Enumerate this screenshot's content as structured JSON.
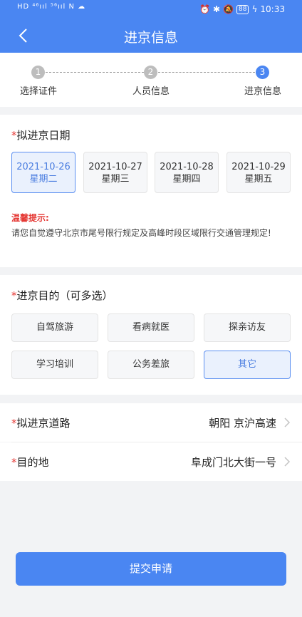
{
  "status_bar": {
    "left": "HD ⁴⁶ııl ⁵⁶ııl N ☁",
    "battery": "88",
    "time": "10:33"
  },
  "nav": {
    "title": "进京信息"
  },
  "steps": [
    {
      "num": "1",
      "label": "选择证件"
    },
    {
      "num": "2",
      "label": "人员信息"
    },
    {
      "num": "3",
      "label": "进京信息"
    }
  ],
  "date_section": {
    "required_mark": "*",
    "title": "拟进京日期",
    "dates": [
      {
        "date": "2021-10-26",
        "weekday": "星期二"
      },
      {
        "date": "2021-10-27",
        "weekday": "星期三"
      },
      {
        "date": "2021-10-28",
        "weekday": "星期四"
      },
      {
        "date": "2021-10-29",
        "weekday": "星期五"
      }
    ],
    "selected_date": "2021-10-26",
    "tip_title": "温馨提示:",
    "tip_text": "请您自觉遵守北京市尾号限行规定及高峰时段区域限行交通管理规定!"
  },
  "purpose_section": {
    "required_mark": "*",
    "title": "进京目的（可多选）",
    "options": [
      "自驾旅游",
      "看病就医",
      "探亲访友",
      "学习培训",
      "公务差旅",
      "其它"
    ],
    "selected": [
      "其它"
    ]
  },
  "route_row": {
    "required_mark": "*",
    "label": "拟进京道路",
    "value": "朝阳  京沪高速"
  },
  "destination_row": {
    "required_mark": "*",
    "label": "目的地",
    "value": "阜成门北大街一号"
  },
  "submit_label": "提交申请",
  "colors": {
    "primary": "#4a86f2",
    "required": "#e53935",
    "selected_bg": "#eaf1fd"
  }
}
